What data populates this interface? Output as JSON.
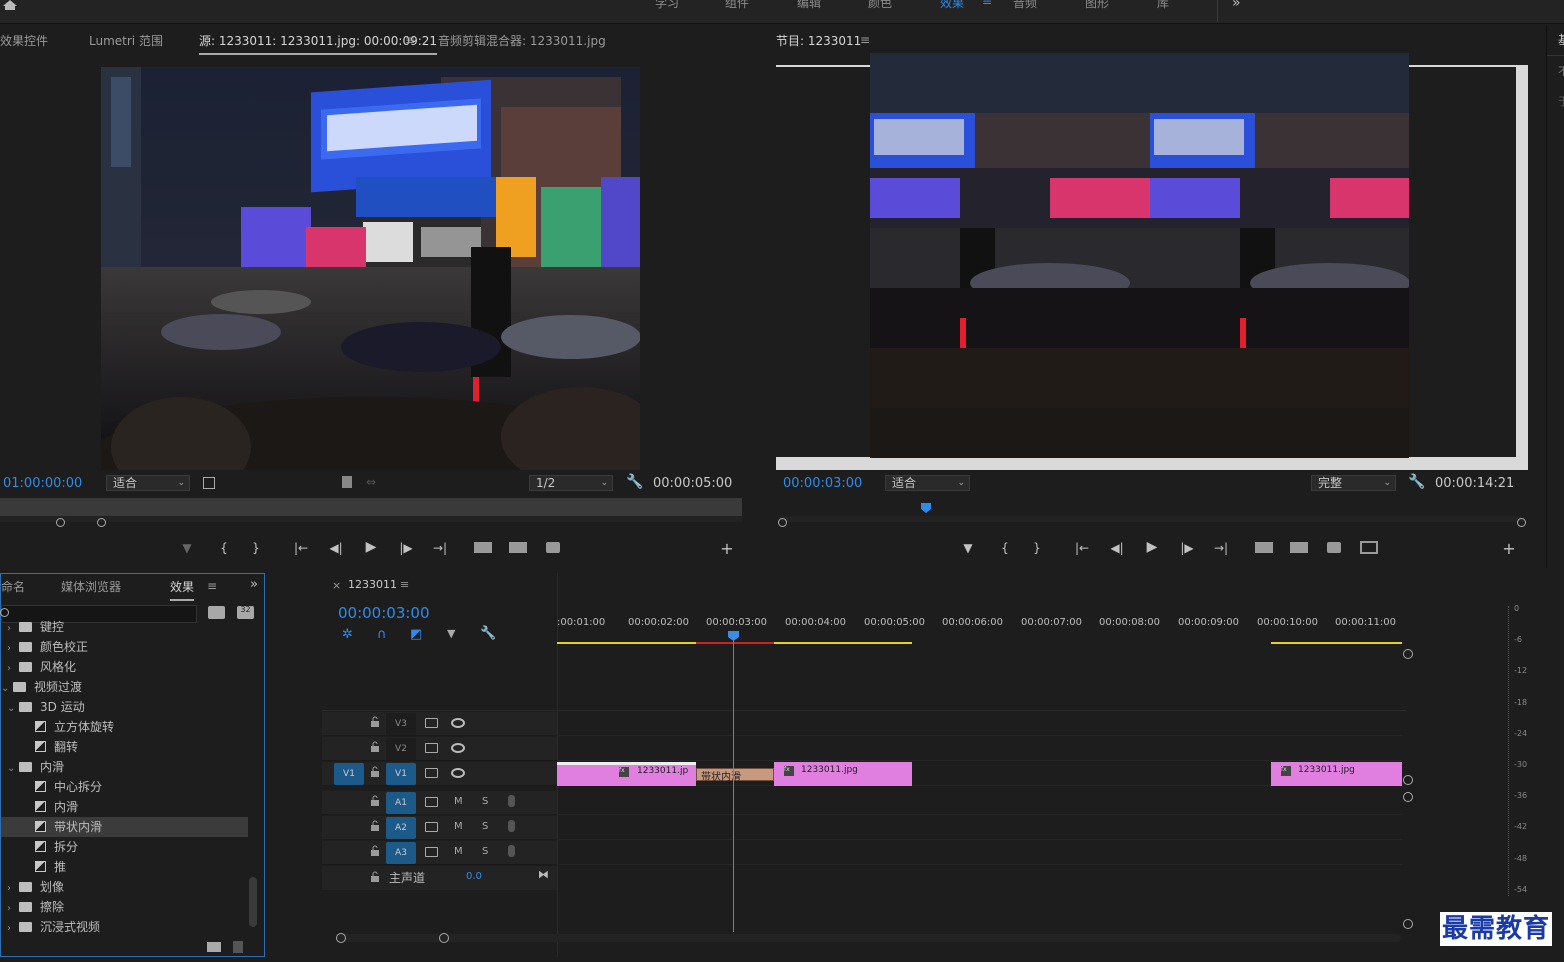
{
  "workspace_tabs": [
    "学习",
    "组件",
    "编辑",
    "颜色",
    "效果",
    "音频",
    "图形",
    "库"
  ],
  "workspace_active": "效果",
  "workspace_menu": "≡",
  "more_chevrons": "»",
  "source_panel": {
    "tabs": [
      "效果控件",
      "Lumetri 范围",
      "源: 1233011: 1233011.jpg: 00:00:09:21",
      "音频剪辑混合器: 1233011.jpg"
    ],
    "active_tab_index": 2,
    "tab_menu": "≡",
    "timecode_left": "01:00:00:00",
    "zoom": "适合",
    "resolution": "1/2",
    "timecode_right": "00:00:05:00"
  },
  "program_panel": {
    "title": "节目: 1233011",
    "menu": "≡",
    "timecode_left": "00:00:03:00",
    "zoom": "适合",
    "quality": "完整",
    "timecode_right": "00:00:14:21"
  },
  "right_edge_tab": "基",
  "right_edge_glyphs": [
    "不",
    "于"
  ],
  "transport": {
    "marker": "▼",
    "in": "{",
    "out": "}",
    "goto_in": "|←",
    "step_back": "◀|",
    "play": "▶",
    "step_fwd": "|▶",
    "goto_out": "→|",
    "add": "+"
  },
  "effects_panel": {
    "tabs": [
      "命名",
      "媒体浏览器",
      "效果"
    ],
    "active_tab": "效果",
    "menu": "≡",
    "expand": "»",
    "items": [
      {
        "label": "键控",
        "type": "folder",
        "indent": 0,
        "arrow": "›"
      },
      {
        "label": "颜色校正",
        "type": "folder",
        "indent": 0,
        "arrow": "›"
      },
      {
        "label": "风格化",
        "type": "folder",
        "indent": 0,
        "arrow": "›"
      },
      {
        "label": "视频过渡",
        "type": "folder",
        "indent": -1,
        "arrow": "⌄"
      },
      {
        "label": "3D 运动",
        "type": "folder",
        "indent": 0,
        "arrow": "⌄"
      },
      {
        "label": "立方体旋转",
        "type": "fx",
        "indent": 1,
        "arrow": ""
      },
      {
        "label": "翻转",
        "type": "fx",
        "indent": 1,
        "arrow": ""
      },
      {
        "label": "内滑",
        "type": "folder",
        "indent": 0,
        "arrow": "⌄"
      },
      {
        "label": "中心拆分",
        "type": "fx",
        "indent": 1,
        "arrow": ""
      },
      {
        "label": "内滑",
        "type": "fx",
        "indent": 1,
        "arrow": ""
      },
      {
        "label": "带状内滑",
        "type": "fx",
        "indent": 1,
        "arrow": "",
        "selected": true
      },
      {
        "label": "拆分",
        "type": "fx",
        "indent": 1,
        "arrow": ""
      },
      {
        "label": "推",
        "type": "fx",
        "indent": 1,
        "arrow": ""
      },
      {
        "label": "划像",
        "type": "folder",
        "indent": 0,
        "arrow": "›"
      },
      {
        "label": "擦除",
        "type": "folder",
        "indent": 0,
        "arrow": "›"
      },
      {
        "label": "沉浸式视频",
        "type": "folder",
        "indent": 0,
        "arrow": "›"
      }
    ]
  },
  "timeline": {
    "close": "×",
    "sequence": "1233011",
    "menu": "≡",
    "timecode": "00:00:03:00",
    "ruler": [
      ":00:01:00",
      "00:00:02:00",
      "00:00:03:00",
      "00:00:04:00",
      "00:00:05:00",
      "00:00:06:00",
      "00:00:07:00",
      "00:00:08:00",
      "00:00:09:00",
      "00:00:10:00",
      "00:00:11:00"
    ],
    "tracks": [
      {
        "name": "V3",
        "lock": "🔒",
        "m": "",
        "s": ""
      },
      {
        "name": "V2",
        "lock": "🔒",
        "m": "",
        "s": ""
      },
      {
        "name": "V1",
        "lock": "🔒",
        "m": "",
        "s": "",
        "src": "V1"
      },
      {
        "name": "A1",
        "lock": "🔒",
        "m": "M",
        "s": "S"
      },
      {
        "name": "A2",
        "lock": "🔒",
        "m": "M",
        "s": "S"
      },
      {
        "name": "A3",
        "lock": "🔒",
        "m": "M",
        "s": "S"
      }
    ],
    "master_label": "主声道",
    "master_value": "0.0",
    "clips": [
      {
        "label": "1233011.jp",
        "fx": "fx"
      },
      {
        "label": "带状内滑",
        "fx": ""
      },
      {
        "label": "1233011.jpg",
        "fx": "fx"
      },
      {
        "label": "1233011.jpg",
        "fx": "fx"
      }
    ]
  },
  "meter_labels": [
    "0",
    "-6",
    "-12",
    "-18",
    "-24",
    "-30",
    "-36",
    "-42",
    "-48",
    "-54"
  ],
  "watermark": "最需教育",
  "colors": {
    "accent": "#2d8ceb",
    "clip": "#e07fdf",
    "transition": "#c79a7f",
    "playhead": "#3b8ce3",
    "selected_track": "#1c5a8a"
  }
}
